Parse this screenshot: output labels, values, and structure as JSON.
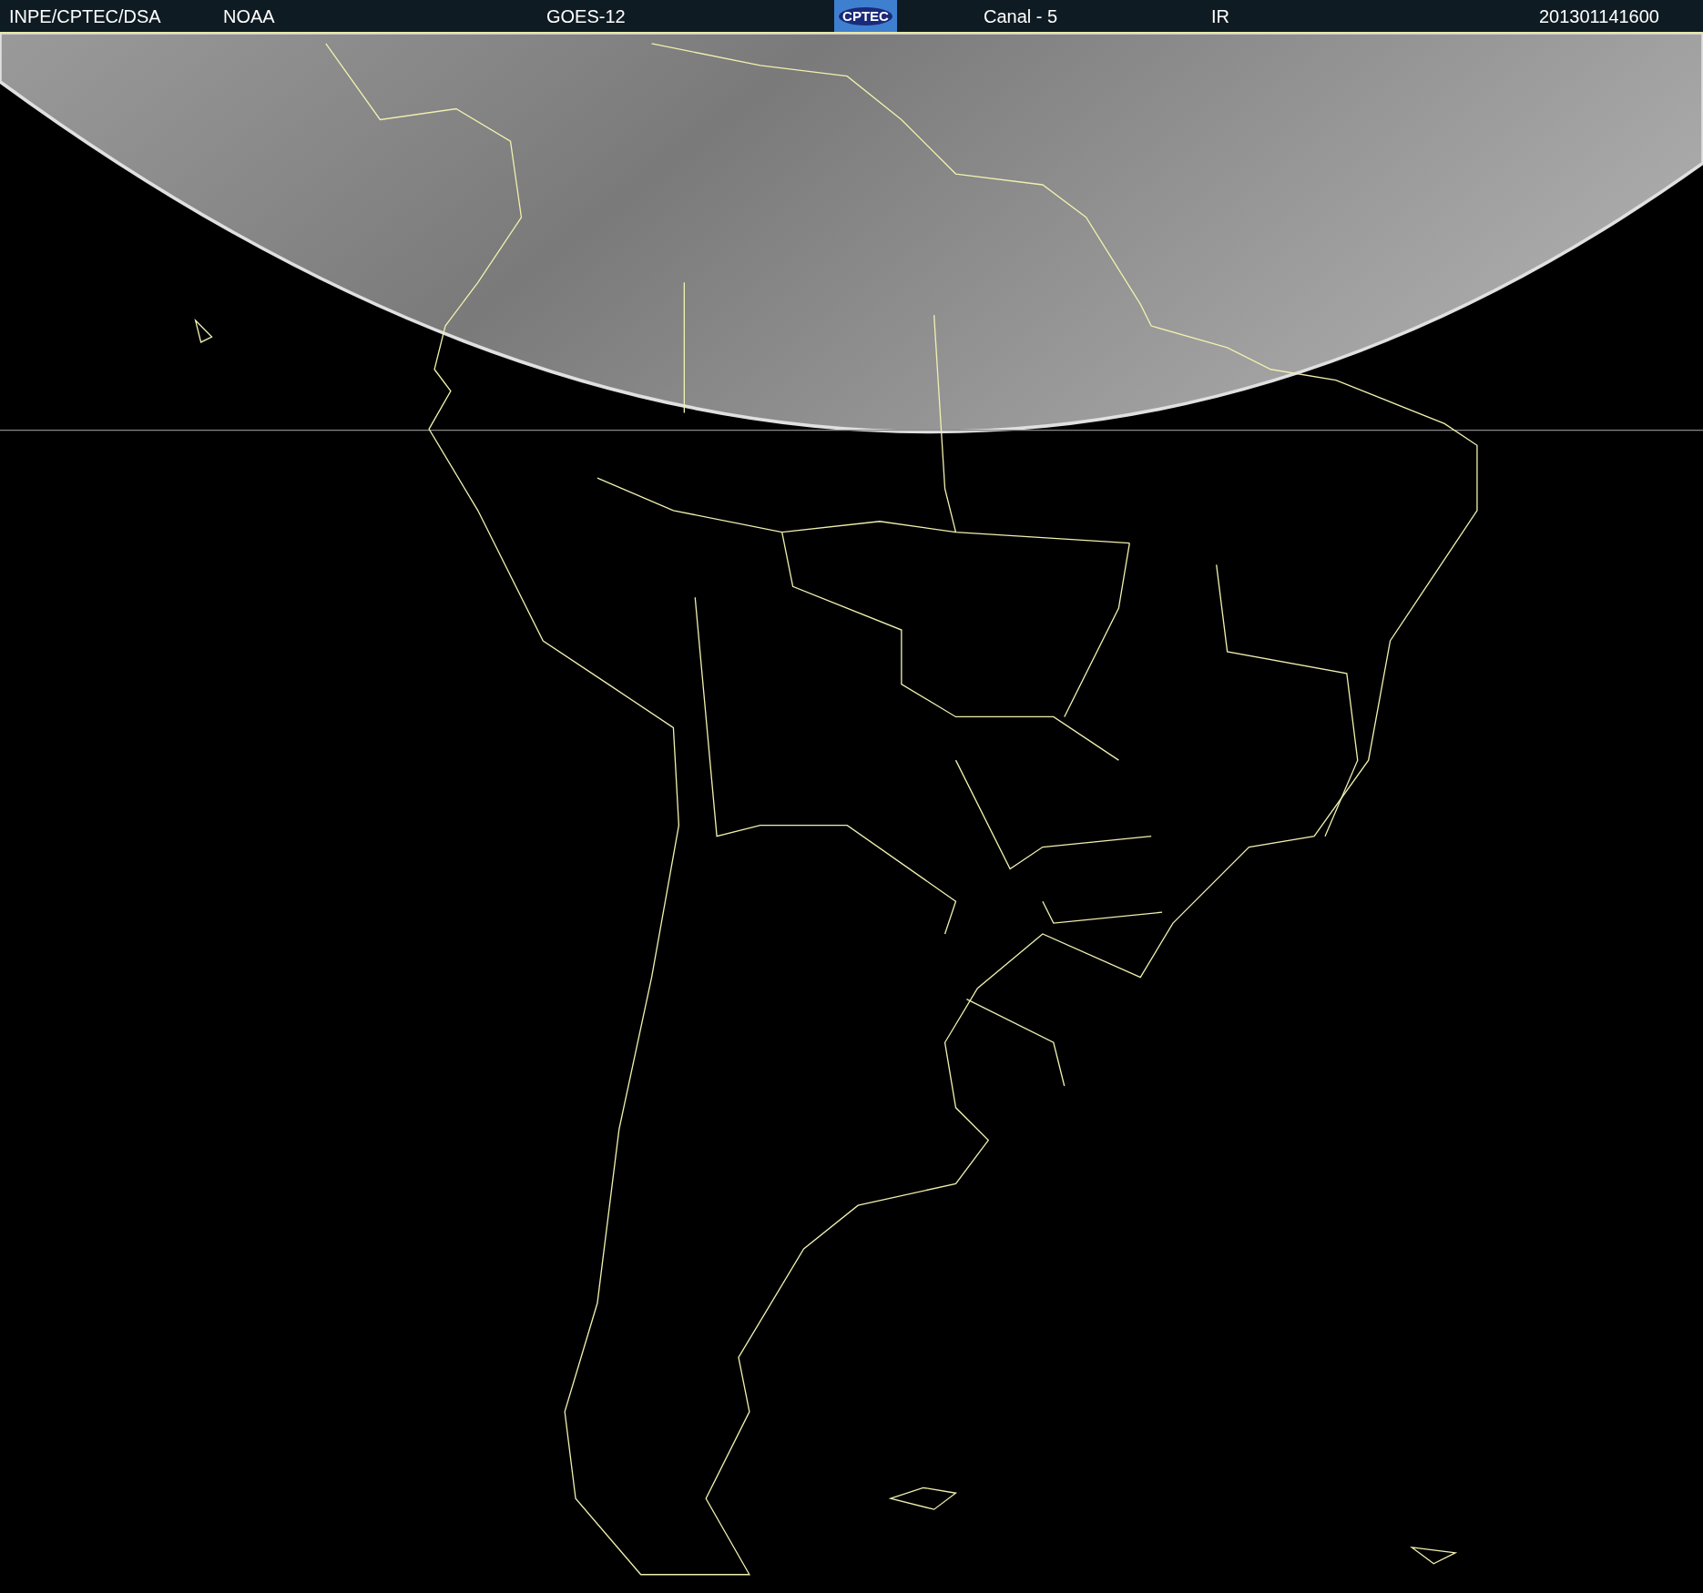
{
  "header": {
    "items": [
      {
        "kind": "text",
        "text": "INPE/CPTEC/DSA"
      },
      {
        "kind": "text",
        "text": "NOAA"
      },
      {
        "kind": "text",
        "text": "GOES-12"
      },
      {
        "kind": "logo",
        "text": "CPTEC"
      },
      {
        "kind": "text",
        "text": "Canal - 5"
      },
      {
        "kind": "text",
        "text": "IR"
      },
      {
        "kind": "text",
        "text": "201301141600"
      }
    ]
  }
}
